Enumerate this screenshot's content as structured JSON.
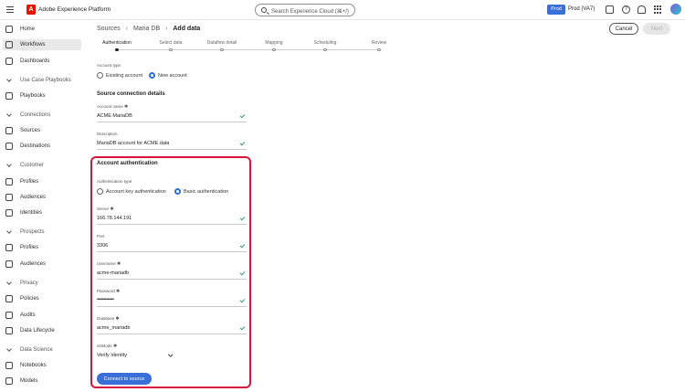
{
  "app": {
    "logo_letter": "A",
    "title": "Adobe Experience Platform",
    "search_placeholder": "Search Experience Cloud (⌘+/)",
    "sandbox_badge": "Prod",
    "sandbox_label": "Prod (VA7)",
    "help_glyph": "?"
  },
  "sidebar": {
    "items_top": [
      {
        "label": "Home",
        "icon": "home-icon"
      },
      {
        "label": "Workflows",
        "icon": "workflows-icon",
        "active": true
      },
      {
        "label": "Dashboards",
        "icon": "dashboards-icon"
      }
    ],
    "sections": [
      {
        "label": "Use Case Playbooks",
        "items": [
          {
            "label": "Playbooks",
            "icon": "playbooks-icon"
          }
        ]
      },
      {
        "label": "Connections",
        "items": [
          {
            "label": "Sources",
            "icon": "sources-icon"
          },
          {
            "label": "Destinations",
            "icon": "destinations-icon"
          }
        ]
      },
      {
        "label": "Customer",
        "items": [
          {
            "label": "Profiles",
            "icon": "profiles-icon"
          },
          {
            "label": "Audiences",
            "icon": "audiences-icon"
          },
          {
            "label": "Identities",
            "icon": "identities-icon"
          }
        ]
      },
      {
        "label": "Prospects",
        "items": [
          {
            "label": "Profiles",
            "icon": "profiles-icon"
          },
          {
            "label": "Audiences",
            "icon": "audiences-icon"
          }
        ]
      },
      {
        "label": "Privacy",
        "items": [
          {
            "label": "Policies",
            "icon": "policies-icon"
          },
          {
            "label": "Audits",
            "icon": "audits-icon"
          },
          {
            "label": "Data Lifecycle",
            "icon": "data-lifecycle-icon"
          }
        ]
      },
      {
        "label": "Data Science",
        "items": [
          {
            "label": "Notebooks",
            "icon": "notebooks-icon"
          },
          {
            "label": "Models",
            "icon": "models-icon"
          }
        ]
      }
    ]
  },
  "breadcrumb": {
    "items": [
      "Sources",
      "Maria DB"
    ],
    "current": "Add data"
  },
  "header_actions": {
    "cancel_label": "Cancel",
    "next_label": "Next"
  },
  "stepper": {
    "steps": [
      "Authentication",
      "Select data",
      "Dataflow detail",
      "Mapping",
      "Scheduling",
      "Review"
    ],
    "active_index": 0
  },
  "form": {
    "account_type": {
      "label": "Account type",
      "options": [
        "Existing account",
        "New account"
      ],
      "selected_index": 1
    },
    "connection_details": {
      "title": "Source connection details",
      "account_name": {
        "label": "Account name",
        "required_mark": "✱",
        "value": "ACME MariaDB"
      },
      "description": {
        "label": "Description",
        "value": "MariaDB account for ACME data"
      }
    },
    "authentication": {
      "title": "Account authentication",
      "auth_type_label": "Authentication type",
      "auth_options": [
        "Account key authentication",
        "Basic authentication"
      ],
      "auth_selected_index": 1,
      "fields": [
        {
          "label": "Server",
          "required_mark": "✱",
          "value": "166.78.144.191"
        },
        {
          "label": "Port",
          "required_mark": "",
          "value": "3306"
        },
        {
          "label": "Username",
          "required_mark": "✱",
          "value": "acme-mariadb"
        },
        {
          "label": "Password",
          "required_mark": "✱",
          "value": "•••••••••••••"
        },
        {
          "label": "Database",
          "required_mark": "✱",
          "value": "acme_mariadb"
        }
      ],
      "ssl_mode": {
        "label": "sslMode",
        "required_mark": "✱",
        "value": "Verify Identity"
      },
      "connect_label": "Connect to source"
    }
  },
  "colors": {
    "accent": "#3a6fd8",
    "highlight": "#d7153a",
    "valid": "#2d9d78",
    "brand": "#eb1000"
  }
}
